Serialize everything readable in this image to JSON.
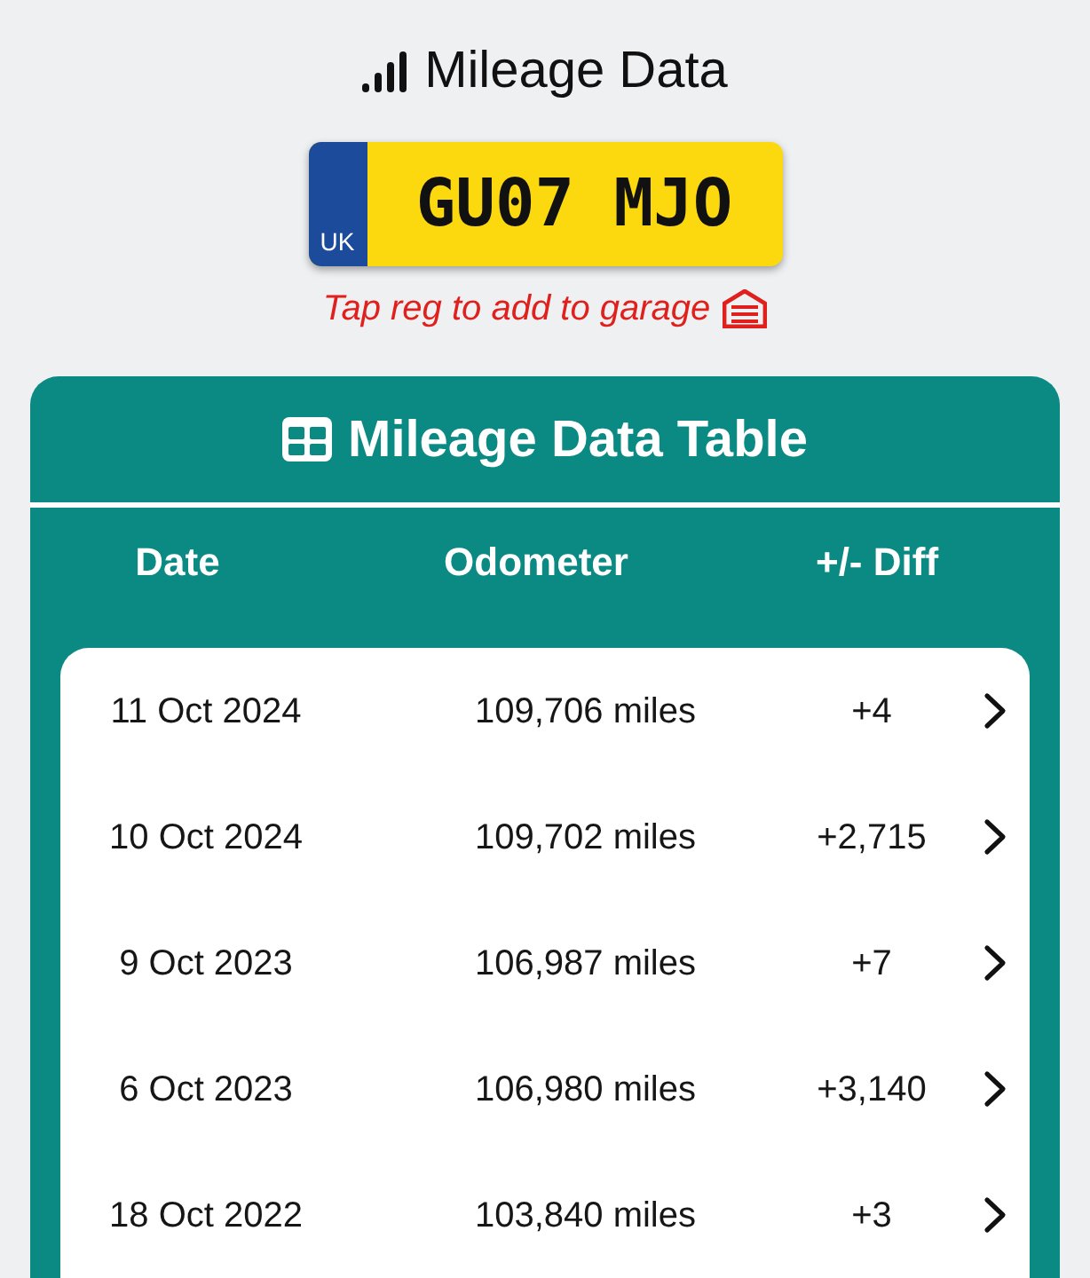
{
  "header": {
    "title": "Mileage Data"
  },
  "plate": {
    "registration": "GU07 MJO",
    "country": "UK"
  },
  "hint": "Tap reg to add to garage",
  "table": {
    "title": "Mileage Data Table",
    "columns": [
      "Date",
      "Odometer",
      "+/- Diff"
    ],
    "rows": [
      {
        "date": "11 Oct 2024",
        "odometer": "109,706 miles",
        "diff": "+4"
      },
      {
        "date": "10 Oct 2024",
        "odometer": "109,702 miles",
        "diff": "+2,715"
      },
      {
        "date": "9 Oct 2023",
        "odometer": "106,987 miles",
        "diff": "+7"
      },
      {
        "date": "6 Oct 2023",
        "odometer": "106,980 miles",
        "diff": "+3,140"
      },
      {
        "date": "18 Oct 2022",
        "odometer": "103,840 miles",
        "diff": "+3"
      }
    ]
  }
}
